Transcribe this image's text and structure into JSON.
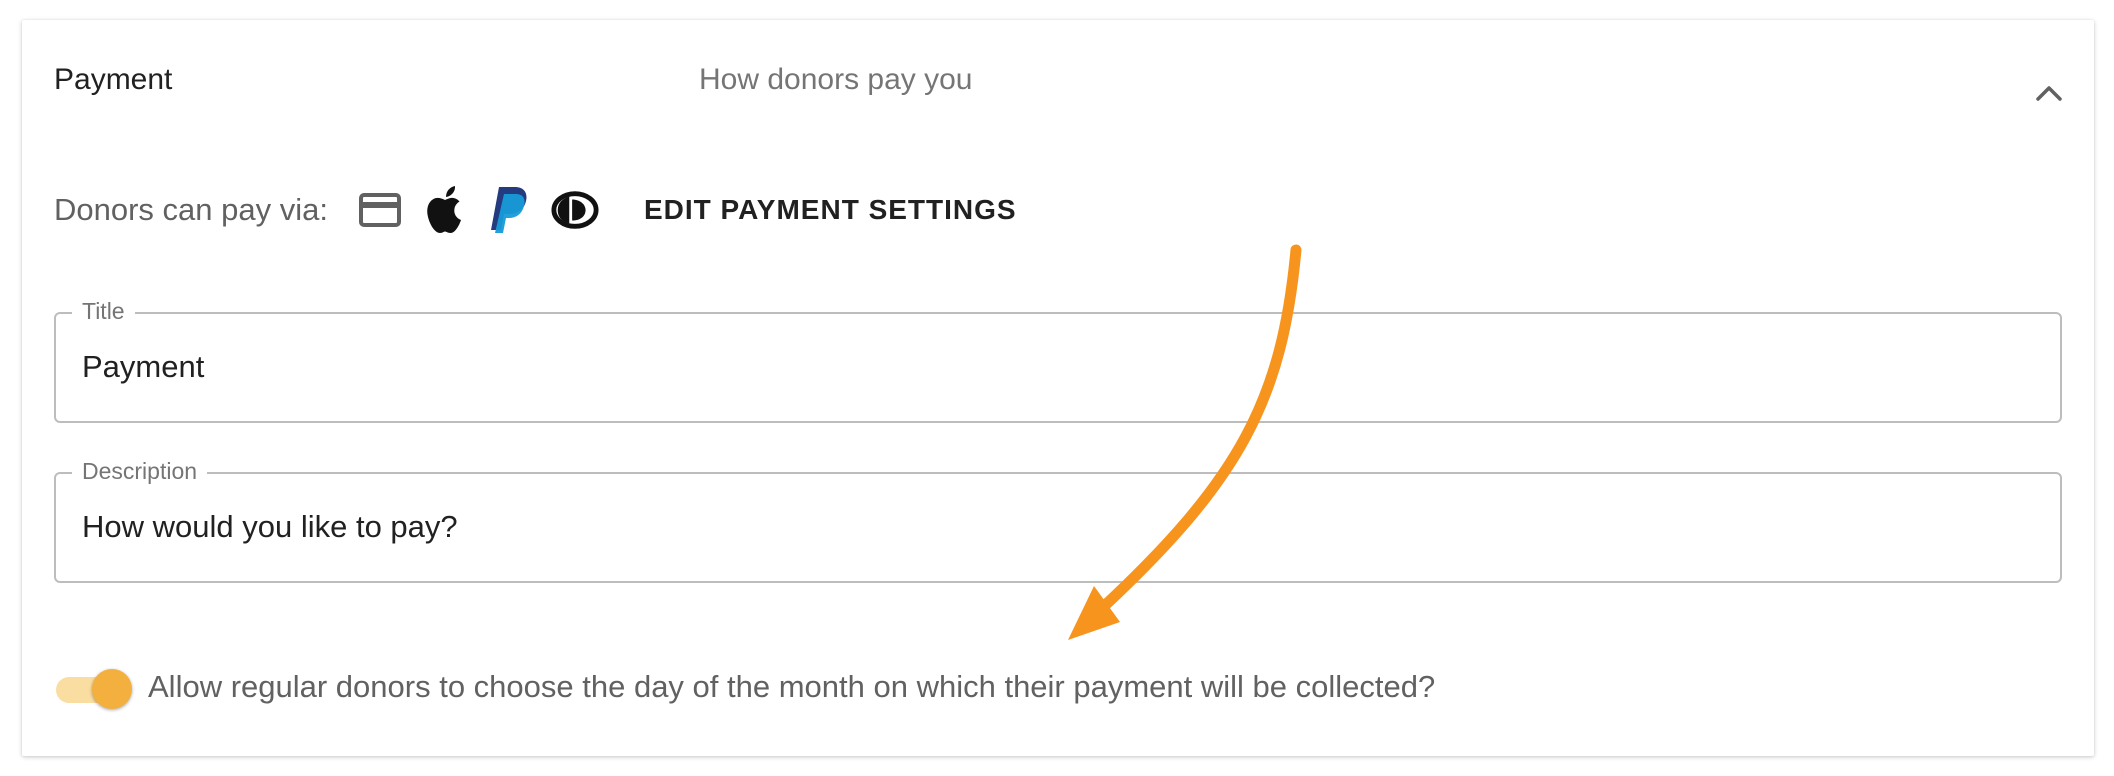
{
  "section": {
    "title": "Payment",
    "subtitle": "How donors pay you",
    "collapse_icon": "chevron-up-icon"
  },
  "payment_methods": {
    "label": "Donors can pay via:",
    "icons": [
      "credit-card-icon",
      "apple-icon",
      "paypal-icon",
      "direct-debit-icon"
    ],
    "edit_button_label": "EDIT PAYMENT SETTINGS"
  },
  "title_field": {
    "label": "Title",
    "value": "Payment"
  },
  "description_field": {
    "label": "Description",
    "value": "How would you like to pay?"
  },
  "day_of_month_toggle": {
    "label": "Allow regular donors to choose the day of the month on which their payment will be collected?",
    "checked": true
  },
  "colors": {
    "accent": "#f4b03e",
    "annotation_arrow": "#f7941d",
    "paypal_dark": "#253b80",
    "paypal_light": "#179bd7"
  }
}
